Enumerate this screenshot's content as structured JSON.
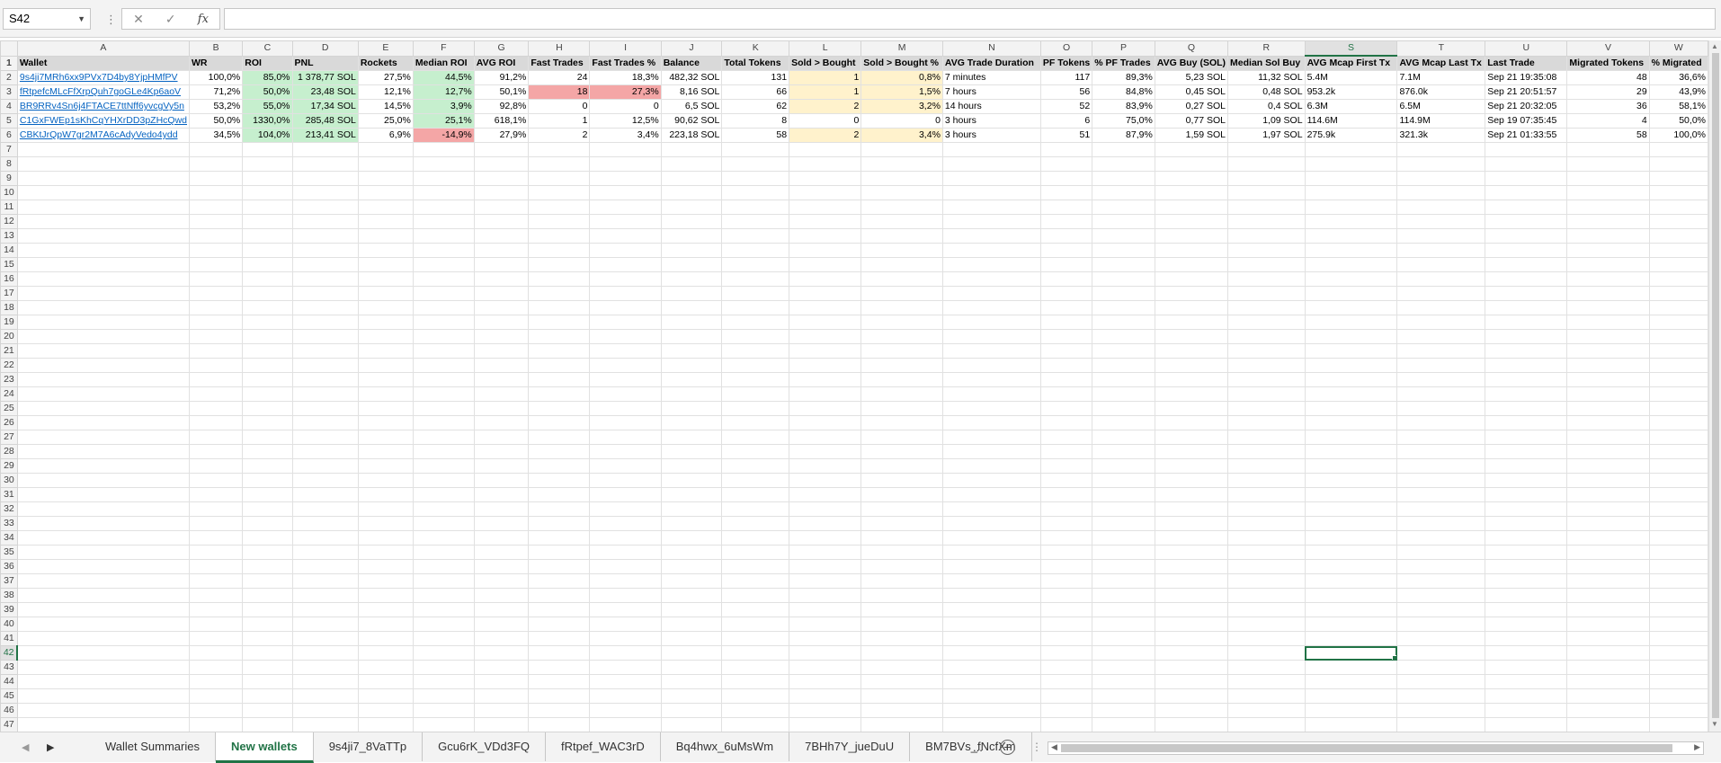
{
  "formula_bar": {
    "name_box": "S42",
    "fx": "fx",
    "cancel": "✕",
    "enter": "✓",
    "value": ""
  },
  "columns": [
    "A",
    "B",
    "C",
    "D",
    "E",
    "F",
    "G",
    "H",
    "I",
    "J",
    "K",
    "L",
    "M",
    "N",
    "O",
    "P",
    "Q",
    "R",
    "S",
    "T",
    "U",
    "V",
    "W"
  ],
  "selected_column": "S",
  "selected_row": 42,
  "headers": [
    "Wallet",
    "WR",
    "ROI",
    "PNL",
    "Rockets",
    "Median ROI",
    "AVG ROI",
    "Fast Trades",
    "Fast Trades %",
    "Balance",
    "Total Tokens",
    "Sold > Bought",
    "Sold > Bought %",
    "AVG Trade Duration",
    "PF Tokens",
    "% PF Trades",
    "AVG Buy (SOL)",
    "Median Sol Buy",
    "AVG Mcap First Tx",
    "AVG Mcap Last Tx",
    "Last Trade",
    "Migrated Tokens",
    "% Migrated"
  ],
  "rows": [
    [
      "9s4ji7MRh6xx9PVx7D4by8YjpHMfPV",
      "100,0%",
      "85,0%",
      "1 378,77 SOL",
      "27,5%",
      "44,5%",
      "91,2%",
      "24",
      "18,3%",
      "482,32 SOL",
      "131",
      "1",
      "0,8%",
      "7 minutes",
      "117",
      "89,3%",
      "5,23 SOL",
      "11,32 SOL",
      "5.4M",
      "7.1M",
      "Sep 21 19:35:08",
      "48",
      "36,6%"
    ],
    [
      "fRtpefcMLcFfXrpQuh7goGLe4Kp6aoV",
      "71,2%",
      "50,0%",
      "23,48 SOL",
      "12,1%",
      "12,7%",
      "50,1%",
      "18",
      "27,3%",
      "8,16 SOL",
      "66",
      "1",
      "1,5%",
      "7 hours",
      "56",
      "84,8%",
      "0,45 SOL",
      "0,48 SOL",
      "953.2k",
      "876.0k",
      "Sep 21 20:51:57",
      "29",
      "43,9%"
    ],
    [
      "BR9RRv4Sn6j4FTACE7ttNff6yvcgVy5n",
      "53,2%",
      "55,0%",
      "17,34 SOL",
      "14,5%",
      "3,9%",
      "92,8%",
      "0",
      "0",
      "6,5 SOL",
      "62",
      "2",
      "3,2%",
      "14 hours",
      "52",
      "83,9%",
      "0,27 SOL",
      "0,4 SOL",
      "6.3M",
      "6.5M",
      "Sep 21 20:32:05",
      "36",
      "58,1%"
    ],
    [
      "C1GxFWEp1sKhCqYHXrDD3pZHcQwd",
      "50,0%",
      "1330,0%",
      "285,48 SOL",
      "25,0%",
      "25,1%",
      "618,1%",
      "1",
      "12,5%",
      "90,62 SOL",
      "8",
      "0",
      "0",
      "3 hours",
      "6",
      "75,0%",
      "0,77 SOL",
      "1,09 SOL",
      "114.6M",
      "114.9M",
      "Sep 19 07:35:45",
      "4",
      "50,0%"
    ],
    [
      "CBKtJrQpW7gr2M7A6cAdyVedo4ydd",
      "34,5%",
      "104,0%",
      "213,41 SOL",
      "6,9%",
      "-14,9%",
      "27,9%",
      "2",
      "3,4%",
      "223,18 SOL",
      "58",
      "2",
      "3,4%",
      "3 hours",
      "51",
      "87,9%",
      "1,59 SOL",
      "1,97 SOL",
      "275.9k",
      "321.3k",
      "Sep 21 01:33:55",
      "58",
      "100,0%"
    ]
  ],
  "cell_fills": [
    {
      "row": 0,
      "fills": {
        "2": "g",
        "3": "g",
        "5": "g",
        "11": "y",
        "12": "y"
      }
    },
    {
      "row": 1,
      "fills": {
        "2": "g",
        "3": "g",
        "5": "g",
        "7": "r",
        "8": "r",
        "11": "y",
        "12": "y"
      }
    },
    {
      "row": 2,
      "fills": {
        "2": "g",
        "3": "g",
        "5": "g",
        "11": "y",
        "12": "y"
      }
    },
    {
      "row": 3,
      "fills": {
        "2": "g",
        "3": "g",
        "5": "g"
      }
    },
    {
      "row": 4,
      "fills": {
        "2": "g",
        "3": "g",
        "5": "r",
        "11": "y",
        "12": "y"
      }
    }
  ],
  "colors": {
    "green_fill": "#c6efce",
    "red_fill": "#f4a6a6",
    "yellow_fill": "#fff2cc",
    "accent": "#217346",
    "link": "#0563c1"
  },
  "sheet_tabs": [
    "Wallet Summaries",
    "New wallets",
    "9s4ji7_8VaTTp",
    "Gcu6rK_VDd3FQ",
    "fRtpef_WAC3rD",
    "Bq4hwx_6uMsWm",
    "7BHh7Y_jueDuU",
    "BM7BVs_fNcfXm"
  ],
  "active_tab": "New wallets",
  "tab_more": "...",
  "tab_add": "+",
  "icons": {
    "prev_sheet": "chevron-left-icon",
    "next_sheet": "chevron-right-icon",
    "add_sheet": "plus-circle-icon"
  }
}
